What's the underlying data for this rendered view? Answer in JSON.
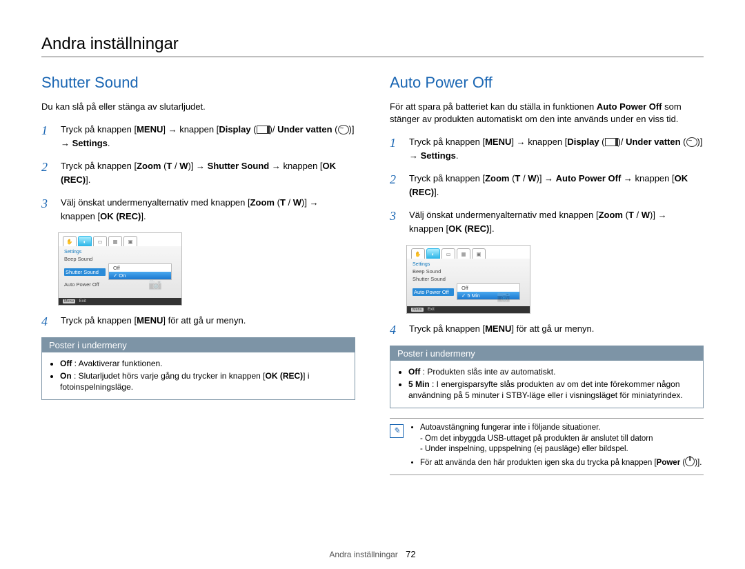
{
  "pageTitle": "Andra inställningar",
  "leftSection": {
    "heading": "Shutter Sound",
    "intro": "Du kan slå på eller stänga av slutarljudet.",
    "steps": {
      "s1": {
        "chunk1": "Tryck på knappen [",
        "b1": "MENU",
        "chunk2": "] → knappen [",
        "b2": "Display",
        "chunk3": " (",
        "chunk4": ")/ ",
        "b3": "Under vatten",
        "chunk5": " (",
        "chunk6": ")] → ",
        "b4": "Settings",
        "chunk7": "."
      },
      "s2": {
        "chunk1": "Tryck på knappen [",
        "b1": "Zoom",
        "chunk2": " (",
        "b2": "T",
        "chunk3": " / ",
        "b3": "W",
        "chunk4": ")] → ",
        "b4": "Shutter Sound",
        "chunk5": " → knappen [",
        "b5": "OK (REC)",
        "chunk6": "]."
      },
      "s3": {
        "chunk1": "Välj önskat undermenyalternativ med knappen [",
        "b1": "Zoom",
        "chunk2": " (",
        "b2": "T",
        "chunk3": " / ",
        "b3": "W",
        "chunk4": ")] → knappen [",
        "b4": "OK (REC)",
        "chunk5": "]."
      },
      "s4": {
        "chunk1": "Tryck på knappen [",
        "b1": "MENU",
        "chunk2": "] för att gå ur menyn."
      }
    },
    "screenmock": {
      "title": "Settings",
      "rows": {
        "r1": "Beep Sound",
        "r2": "Shutter Sound",
        "r3": "Auto Power Off"
      },
      "opts": {
        "o1": "Off",
        "o2": "On"
      },
      "check": "✓",
      "exit": "Exit",
      "menu": "Menu"
    },
    "poster": {
      "head": "Poster i undermeny",
      "off": {
        "b": "Off",
        "text": " : Avaktiverar funktionen."
      },
      "on": {
        "b": "On",
        "text": " : Slutarljudet hörs varje gång du trycker in knappen [",
        "b2": "OK (REC)",
        "text2": "] i fotoinspelningsläge."
      }
    }
  },
  "rightSection": {
    "heading": "Auto Power Off",
    "introParts": {
      "p1": "För att spara på batteriet kan du ställa in funktionen ",
      "b": "Auto Power Off",
      "p2": " som stänger av produkten automatiskt om den inte används under en viss tid."
    },
    "steps": {
      "s1": {
        "chunk1": "Tryck på knappen [",
        "b1": "MENU",
        "chunk2": "] → knappen [",
        "b2": "Display",
        "chunk3": " (",
        "chunk4": ")/ ",
        "b3": "Under vatten",
        "chunk5": " (",
        "chunk6": ")] → ",
        "b4": "Settings",
        "chunk7": "."
      },
      "s2": {
        "chunk1": "Tryck på knappen [",
        "b1": "Zoom",
        "chunk2": " (",
        "b2": "T",
        "chunk3": " / ",
        "b3": "W",
        "chunk4": ")] → ",
        "b4": "Auto Power Off",
        "chunk5": " → knappen [",
        "b5": "OK (REC)",
        "chunk6": "]."
      },
      "s3": {
        "chunk1": "Välj önskat undermenyalternativ med knappen [",
        "b1": "Zoom",
        "chunk2": " (",
        "b2": "T",
        "chunk3": " / ",
        "b3": "W",
        "chunk4": ")] → knappen [",
        "b4": "OK (REC)",
        "chunk5": "]."
      },
      "s4": {
        "chunk1": "Tryck på knappen [",
        "b1": "MENU",
        "chunk2": "] för att gå ur menyn."
      }
    },
    "screenmock": {
      "title": "Settings",
      "rows": {
        "r1": "Beep Sound",
        "r2": "Shutter Sound",
        "r3": "Auto Power Off"
      },
      "opts": {
        "o1": "Off",
        "o2": "5 Min"
      },
      "check": "✓",
      "exit": "Exit",
      "menu": "Menu"
    },
    "poster": {
      "head": "Poster i undermeny",
      "off": {
        "b": "Off",
        "text": " : Produkten slås inte av automatiskt."
      },
      "five": {
        "b": "5 Min",
        "text": " : I energisparsyfte slås produkten av om det inte förekommer någon användning på 5 minuter i STBY-läge eller i visningsläget för miniatyrindex."
      }
    },
    "note": {
      "l1": "Autoavstängning fungerar inte i följande situationer.",
      "l1a": "- Om det inbyggda USB-uttaget på produkten är anslutet till datorn",
      "l1b": "- Under inspelning, uppspelning (ej pausläge) eller bildspel.",
      "l2a": "För att använda den här produkten igen ska du trycka på knappen [",
      "l2b": "Power",
      "l2c": " (",
      "l2d": ")]."
    }
  },
  "footer": {
    "label": "Andra inställningar",
    "page": "72"
  },
  "glyphs": {
    "arrow": "→",
    "hand": "✋",
    "globe": "◐",
    "video": "▭",
    "photo": "▦",
    "play": "▣",
    "note": "✎"
  }
}
